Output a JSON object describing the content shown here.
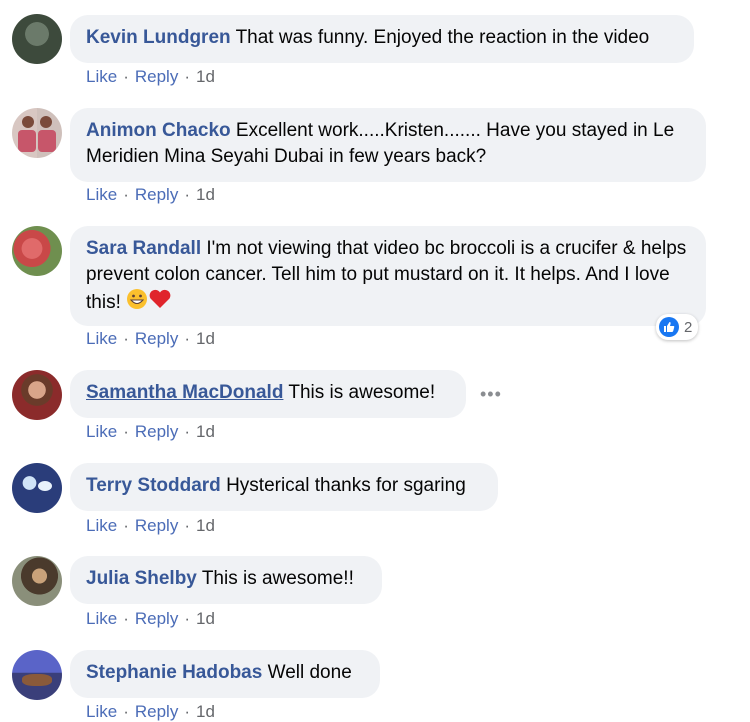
{
  "comments": [
    {
      "name": "Kevin Lundgren",
      "text": "That was funny. Enjoyed the reaction in the video",
      "like": "Like",
      "reply": "Reply",
      "time": "1d"
    },
    {
      "name": "Animon Chacko",
      "text": "Excellent work.....Kristen....... Have you stayed in Le Meridien Mina Seyahi Dubai in few years back?",
      "like": "Like",
      "reply": "Reply",
      "time": "1d"
    },
    {
      "name": "Sara Randall",
      "text": "I'm not viewing that video bc broccoli is a crucifer & helps prevent colon cancer. Tell him to put mustard on it. It helps. And I love this!",
      "like": "Like",
      "reply": "Reply",
      "time": "1d",
      "reaction_count": "2"
    },
    {
      "name": "Samantha MacDonald",
      "text": "This is awesome!",
      "like": "Like",
      "reply": "Reply",
      "time": "1d"
    },
    {
      "name": "Terry Stoddard",
      "text": "Hysterical thanks for sgaring",
      "like": "Like",
      "reply": "Reply",
      "time": "1d"
    },
    {
      "name": "Julia Shelby",
      "text": "This is awesome!!",
      "like": "Like",
      "reply": "Reply",
      "time": "1d"
    },
    {
      "name": "Stephanie Hadobas",
      "text": "Well done",
      "like": "Like",
      "reply": "Reply",
      "time": "1d"
    }
  ],
  "more_options": "•••",
  "colors": {
    "name": "#385898",
    "bubble": "#f0f2f5",
    "meta": "#65676b",
    "like_blue": "#1877f2"
  }
}
